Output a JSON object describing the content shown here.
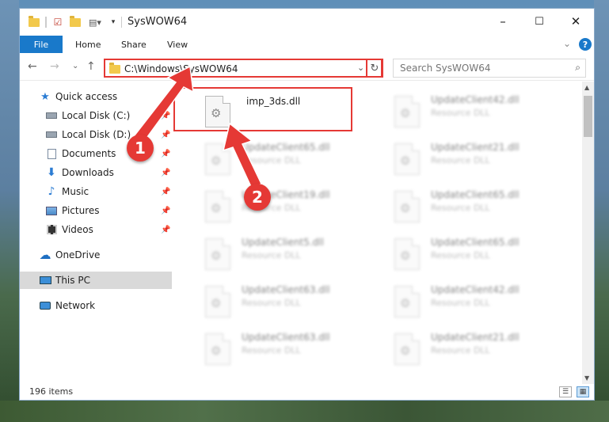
{
  "window": {
    "title": "SysWOW64",
    "minimize": "–",
    "maximize": "☐",
    "close": "✕"
  },
  "ribbon": {
    "file": "File",
    "home": "Home",
    "share": "Share",
    "view": "View",
    "help": "?",
    "expand": "⌄"
  },
  "nav": {
    "back": "←",
    "forward": "→",
    "recent": "⌄",
    "up": "↑",
    "path": "C:\\Windows\\SysWOW64",
    "dropdown": "⌄",
    "refresh": "↻"
  },
  "search": {
    "placeholder": "Search SysWOW64",
    "icon": "search-icon"
  },
  "sidebar": {
    "items": [
      {
        "label": "Quick access",
        "icon": "star-icon"
      },
      {
        "label": "Local Disk (C:)",
        "icon": "drive-icon"
      },
      {
        "label": "Local Disk (D:)",
        "icon": "drive-icon"
      },
      {
        "label": "Documents",
        "icon": "documents-icon"
      },
      {
        "label": "Downloads",
        "icon": "downloads-icon"
      },
      {
        "label": "Music",
        "icon": "music-icon"
      },
      {
        "label": "Pictures",
        "icon": "pictures-icon"
      },
      {
        "label": "Videos",
        "icon": "videos-icon"
      },
      {
        "label": "OneDrive",
        "icon": "cloud-icon"
      },
      {
        "label": "This PC",
        "icon": "computer-icon"
      },
      {
        "label": "Network",
        "icon": "network-icon"
      }
    ]
  },
  "files": {
    "highlighted": {
      "name": "imp_3ds.dll"
    },
    "left": [
      {
        "name": "UpdateClient65.dll",
        "type": "Resource DLL"
      },
      {
        "name": "UpdateClient19.dll",
        "type": "Resource DLL"
      },
      {
        "name": "UpdateClient5.dll",
        "type": "Resource DLL"
      },
      {
        "name": "UpdateClient63.dll",
        "type": "Resource DLL"
      },
      {
        "name": "UpdateClient63.dll",
        "type": "Resource DLL"
      }
    ],
    "right": [
      {
        "name": "UpdateClient42.dll",
        "type": "Resource DLL"
      },
      {
        "name": "UpdateClient21.dll",
        "type": "Resource DLL"
      },
      {
        "name": "UpdateClient65.dll",
        "type": "Resource DLL"
      },
      {
        "name": "UpdateClient65.dll",
        "type": "Resource DLL"
      },
      {
        "name": "UpdateClient42.dll",
        "type": "Resource DLL"
      },
      {
        "name": "UpdateClient21.dll",
        "type": "Resource DLL"
      }
    ]
  },
  "status": {
    "count": "196 items"
  },
  "annotations": {
    "one": "1",
    "two": "2",
    "color": "#e53935"
  }
}
